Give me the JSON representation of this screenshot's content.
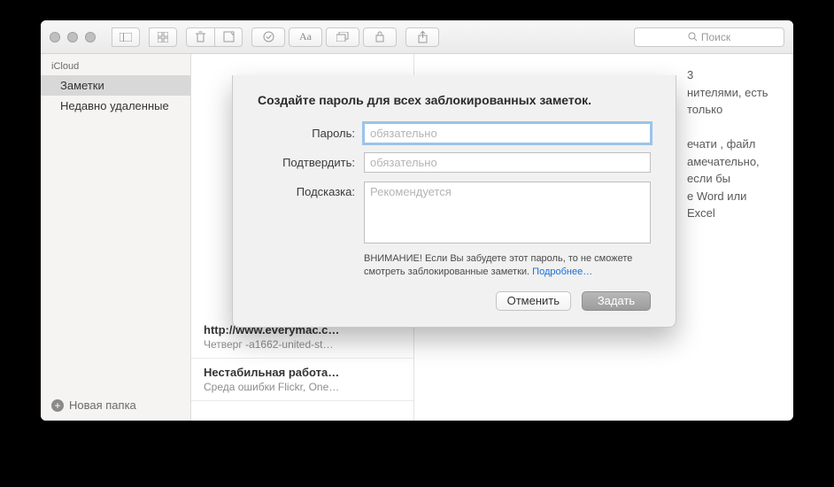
{
  "toolbar": {
    "search_placeholder": "Поиск"
  },
  "sidebar": {
    "header": "iCloud",
    "items": [
      {
        "label": "Заметки"
      },
      {
        "label": "Недавно удаленные"
      }
    ],
    "new_folder": "Новая папка"
  },
  "notelist": [
    {
      "title": "http://www.everymac.c…",
      "sub": "Четверг   -a1662-united-st…"
    },
    {
      "title": "Нестабильная работа…",
      "sub": "Среда   ошибки Flickr, One…"
    }
  ],
  "content": {
    "fragment": "3\nнителями, есть только\n\nечати , файл\nамечательно, если бы\nе Word или Excel"
  },
  "dialog": {
    "title": "Создайте пароль для всех заблокированных заметок.",
    "password_label": "Пароль:",
    "confirm_label": "Подтвердить:",
    "hint_label": "Подсказка:",
    "required_placeholder": "обязательно",
    "hint_placeholder": "Рекомендуется",
    "warning_text": "ВНИМАНИЕ! Если Вы забудете этот пароль, то не сможете смотреть заблокированные заметки. ",
    "warning_link": "Подробнее…",
    "cancel": "Отменить",
    "submit": "Задать"
  }
}
